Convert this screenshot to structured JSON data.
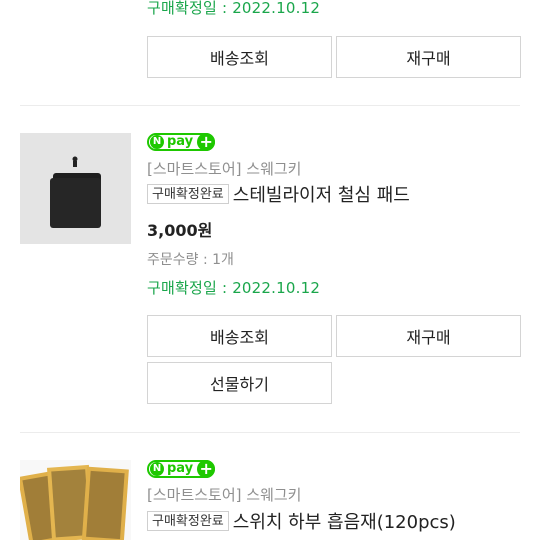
{
  "order1": {
    "confirm_date": "구매확정일 : 2022.10.12",
    "buttons": {
      "delivery": "배송조회",
      "rebuy": "재구매"
    }
  },
  "order2": {
    "npay": {
      "n": "N",
      "pay": "pay",
      "plus": "+"
    },
    "store": "[스마트스토어] 스웨그키",
    "status_badge": "구매확정완료",
    "product_name": "스테빌라이저 철심 패드",
    "price": "3,000원",
    "quantity": "주문수량 : 1개",
    "confirm_date": "구매확정일 : 2022.10.12",
    "buttons": {
      "delivery": "배송조회",
      "rebuy": "재구매",
      "gift": "선물하기"
    }
  },
  "order3": {
    "npay": {
      "n": "N",
      "pay": "pay",
      "plus": "+"
    },
    "store": "[스마트스토어] 스웨그키",
    "status_badge": "구매확정완료",
    "product_name": "스위치 하부 흡음재(120pcs)"
  },
  "colors": {
    "accent_green": "#1aa64b",
    "npay_green": "#1ec800",
    "border": "#d4d4d4"
  }
}
